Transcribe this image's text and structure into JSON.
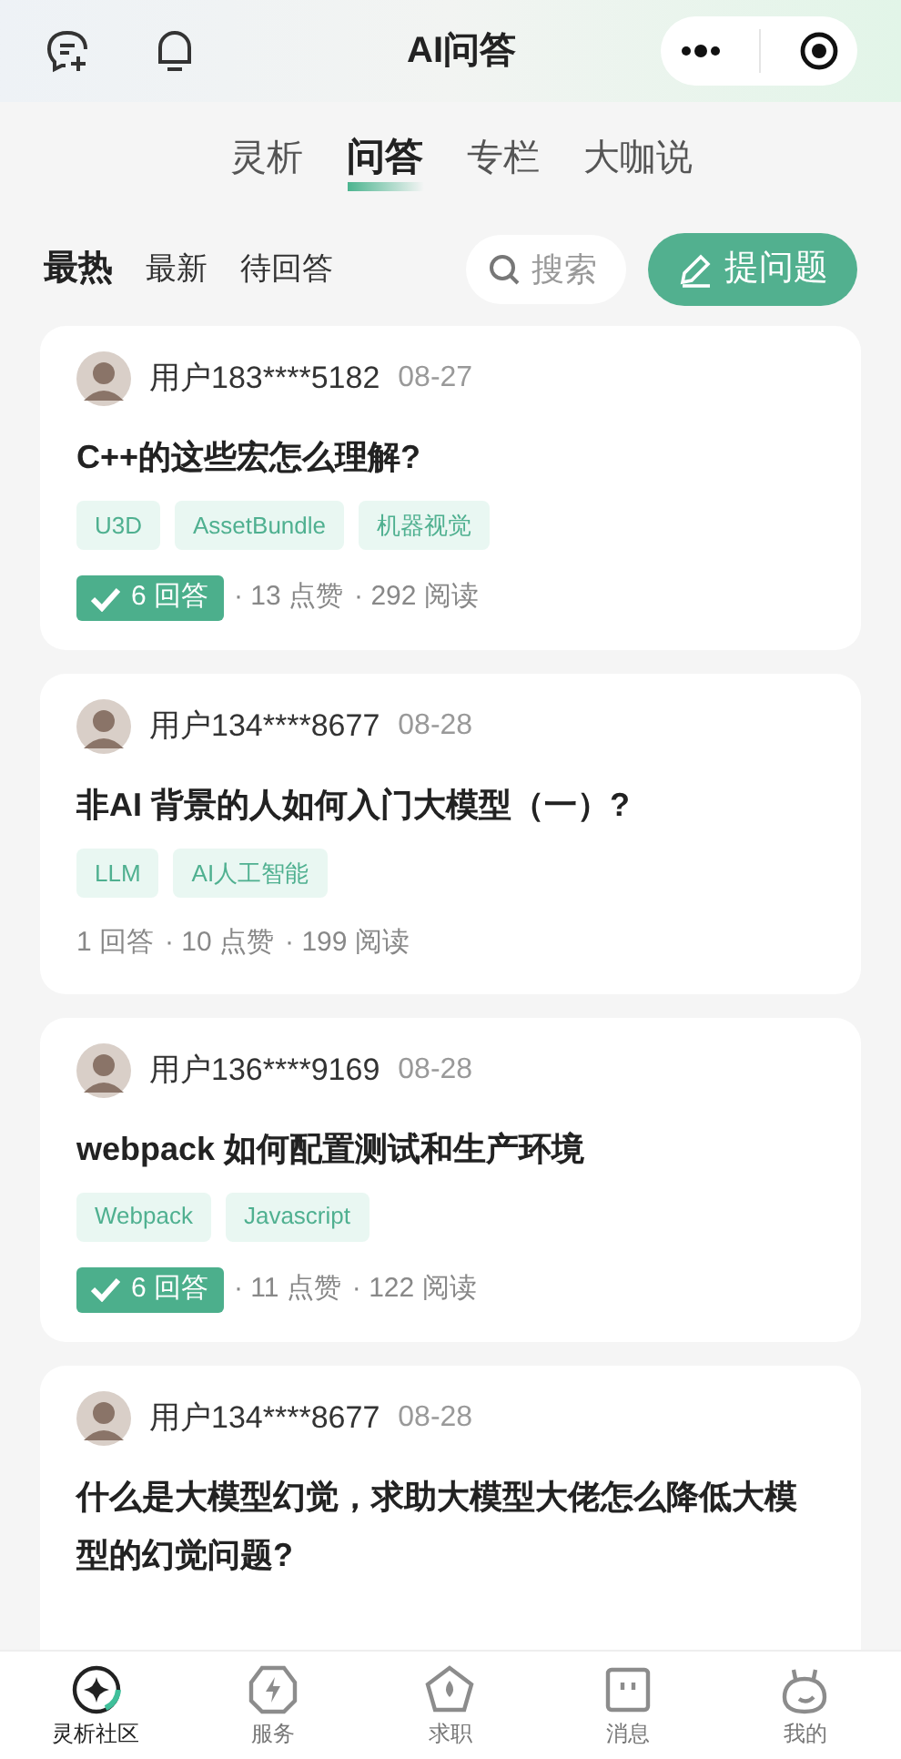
{
  "header": {
    "title": "AI问答"
  },
  "tabs": [
    {
      "label": "灵析",
      "selected": false
    },
    {
      "label": "问答",
      "selected": true
    },
    {
      "label": "专栏",
      "selected": false
    },
    {
      "label": "大咖说",
      "selected": false
    }
  ],
  "filters": [
    {
      "label": "最热",
      "selected": true
    },
    {
      "label": "最新",
      "selected": false
    },
    {
      "label": "待回答",
      "selected": false
    }
  ],
  "search": {
    "placeholder": "搜索"
  },
  "ask_button": {
    "label": "提问题"
  },
  "questions": [
    {
      "user": "用户183****5182",
      "date": "08-27",
      "title": "C++的这些宏怎么理解?",
      "tags": [
        "U3D",
        "AssetBundle",
        "机器视觉"
      ],
      "answers": "6 回答",
      "accepted": true,
      "likes": "· 13 点赞",
      "reads": "· 292 阅读"
    },
    {
      "user": "用户134****8677",
      "date": "08-28",
      "title": "非AI 背景的人如何入门大模型（一）?",
      "tags": [
        "LLM",
        "AI人工智能"
      ],
      "answers": "1 回答",
      "accepted": false,
      "likes": "· 10 点赞",
      "reads": "· 199 阅读"
    },
    {
      "user": "用户136****9169",
      "date": "08-28",
      "title": "webpack 如何配置测试和生产环境",
      "tags": [
        "Webpack",
        "Javascript"
      ],
      "answers": "6 回答",
      "accepted": true,
      "likes": "· 11 点赞",
      "reads": "· 122 阅读"
    },
    {
      "user": "用户134****8677",
      "date": "08-28",
      "title": "什么是大模型幻觉，求助大模型大佬怎么降低大模型的幻觉问题?"
    }
  ],
  "nav": [
    {
      "label": "灵析社区",
      "kind": "community",
      "selected": true
    },
    {
      "label": "服务",
      "kind": "service",
      "selected": false
    },
    {
      "label": "求职",
      "kind": "job",
      "selected": false
    },
    {
      "label": "消息",
      "kind": "message",
      "selected": false
    },
    {
      "label": "我的",
      "kind": "me",
      "selected": false
    }
  ]
}
